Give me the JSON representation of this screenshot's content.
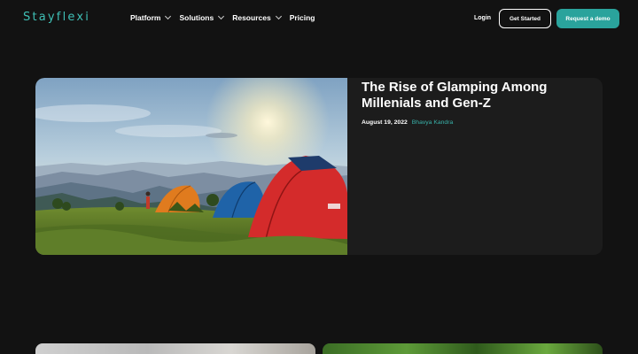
{
  "brand": {
    "logo": "Stayflexi"
  },
  "nav": {
    "items": [
      {
        "label": "Platform",
        "has_dropdown": true
      },
      {
        "label": "Solutions",
        "has_dropdown": true
      },
      {
        "label": "Resources",
        "has_dropdown": true
      },
      {
        "label": "Pricing",
        "has_dropdown": false
      }
    ],
    "login": "Login",
    "get_started": "Get Started",
    "request_demo": "Request a demo"
  },
  "featured": {
    "title": "The Rise of Glamping Among Millenials and Gen-Z",
    "date": "August 19, 2022",
    "author": "Bhavya Kandra",
    "image": "camping-tents-on-hill-at-sunset"
  },
  "colors": {
    "background": "#121212",
    "accent": "#2aa39c",
    "card": "#1c1c1c"
  }
}
